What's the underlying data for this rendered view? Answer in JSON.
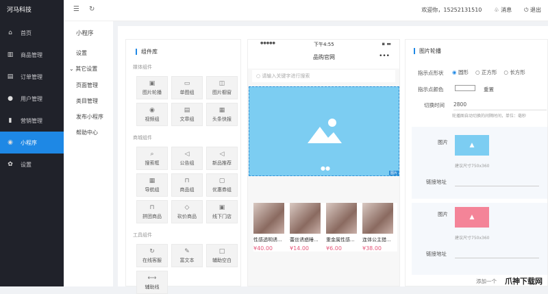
{
  "brand": "河马科技",
  "sidebar": {
    "items": [
      {
        "label": "首页",
        "icon": "home-icon",
        "glyph": "⌂"
      },
      {
        "label": "商品管理",
        "icon": "goods-icon",
        "glyph": "▥"
      },
      {
        "label": "订单管理",
        "icon": "order-icon",
        "glyph": "▤"
      },
      {
        "label": "用户管理",
        "icon": "user-icon",
        "glyph": "●"
      },
      {
        "label": "营销管理",
        "icon": "marketing-icon",
        "glyph": "▮"
      },
      {
        "label": "小程序",
        "icon": "miniprogram-icon",
        "glyph": "◉",
        "active": true
      },
      {
        "label": "设置",
        "icon": "settings-icon",
        "glyph": "✿"
      }
    ]
  },
  "subnav": {
    "title": "小程序",
    "items": [
      "设置",
      "其它设置",
      "页面管理",
      "类目管理",
      "发布小程序",
      "帮助中心"
    ]
  },
  "topbar": {
    "welcome": "欢迎你，15252131510",
    "messages": "消息",
    "logout": "退出"
  },
  "library": {
    "title": "组件库",
    "sections": [
      {
        "name": "媒体组件",
        "items": [
          [
            "图片轮播",
            "▣"
          ],
          [
            "单图组",
            "▭"
          ],
          [
            "图片橱窗",
            "◫"
          ],
          [
            "视频组",
            "◉"
          ],
          [
            "文章组",
            "▤"
          ],
          [
            "头条快报",
            "▦"
          ]
        ]
      },
      {
        "name": "商城组件",
        "items": [
          [
            "搜索框",
            "⌕"
          ],
          [
            "公告组",
            "◁"
          ],
          [
            "新品推荐",
            "◁"
          ],
          [
            "导航组",
            "▦"
          ],
          [
            "商品组",
            "⊓"
          ],
          [
            "优惠券组",
            "▢"
          ],
          [
            "拼团商品",
            "⊓"
          ],
          [
            "砍价商品",
            "◇"
          ],
          [
            "线下门店",
            "▣"
          ]
        ]
      },
      {
        "name": "工具组件",
        "items": [
          [
            "在线客服",
            "↻"
          ],
          [
            "富文本",
            "✎"
          ],
          [
            "辅助空白",
            "□"
          ],
          [
            "辅助线",
            "⟷"
          ]
        ]
      }
    ]
  },
  "phone": {
    "carrier": "●●●●●",
    "time": "下午4:55",
    "title": "品购官网",
    "more": "•••",
    "search_placeholder": "请输入关键字进行搜索",
    "banner_tag": "图片",
    "products": [
      {
        "name": "性感透明诱...",
        "price": "¥40.00"
      },
      {
        "name": "蕾丝诱惑睡...",
        "price": "¥14.00"
      },
      {
        "name": "重金属性感...",
        "price": "¥6.00"
      },
      {
        "name": "连体公主猎...",
        "price": "¥38.00"
      }
    ]
  },
  "props": {
    "title": "图片轮播",
    "shape_label": "指示点形状",
    "shapes": [
      "圆形",
      "正方形",
      "长方形"
    ],
    "color_label": "指示点颜色",
    "reset": "重置",
    "interval_label": "切换时间",
    "interval": "2800",
    "interval_hint": "轮播图自动切换的间隔时间，单位：毫秒",
    "slides": [
      {
        "image_label": "图片",
        "size_hint": "建议尺寸750x360",
        "link_label": "链接地址",
        "color": "#7ccdf2"
      },
      {
        "image_label": "图片",
        "size_hint": "建议尺寸750x360",
        "link_label": "链接地址",
        "color": "#f48498"
      }
    ],
    "add": "添加一个"
  },
  "watermark": "爪神下载网"
}
